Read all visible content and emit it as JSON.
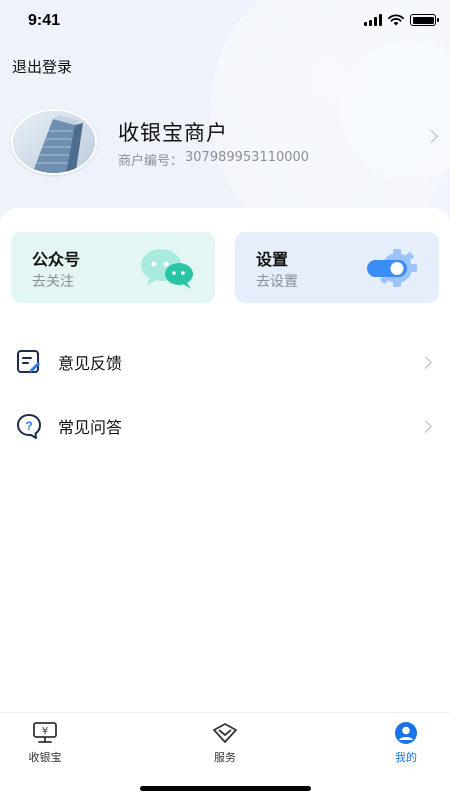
{
  "status_bar": {
    "time": "9:41"
  },
  "header": {
    "logout_label": "退出登录",
    "merchant_name": "收银宝商户",
    "merchant_id_label": "商户编号：",
    "merchant_id": "307989953110000"
  },
  "cards": [
    {
      "title": "公众号",
      "subtitle": "去关注",
      "icon": "wechat-bubble-icon"
    },
    {
      "title": "设置",
      "subtitle": "去设置",
      "icon": "settings-gear-toggle-icon"
    }
  ],
  "menu": [
    {
      "label": "意见反馈",
      "icon": "feedback-edit-icon"
    },
    {
      "label": "常见问答",
      "icon": "question-bubble-icon"
    }
  ],
  "tabbar": {
    "items": [
      {
        "label": "收银宝",
        "icon": "cashier-screen-icon",
        "active": false
      },
      {
        "label": "服务",
        "icon": "diamond-icon",
        "active": false
      },
      {
        "label": "我的",
        "icon": "user-icon",
        "active": true
      }
    ]
  },
  "colors": {
    "accent": "#1a73e8",
    "wechat_card_bg": "#e3f6f3",
    "settings_card_bg": "#e6eefb",
    "wechat_green": "#2bc4a4",
    "settings_blue": "#3b8df6"
  }
}
